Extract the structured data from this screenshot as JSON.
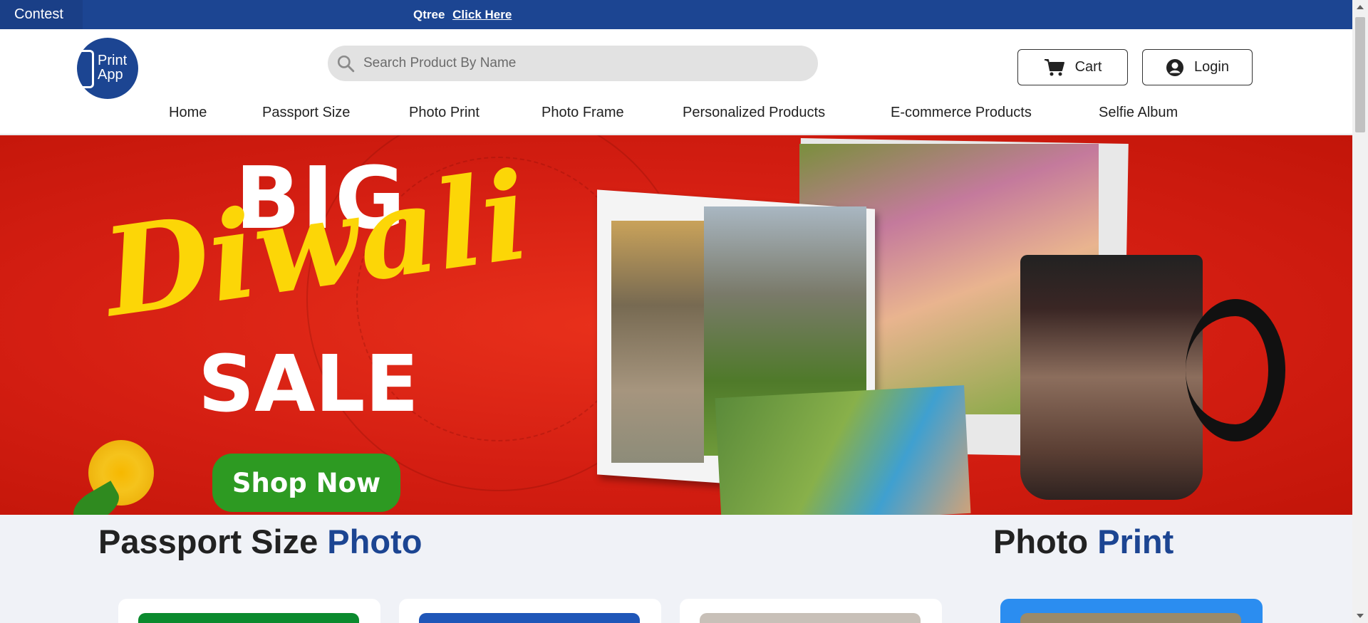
{
  "topbar": {
    "contest_label": "Contest",
    "promo_text": "Qtree",
    "promo_link": "Click Here",
    "color": "#1c4592"
  },
  "header": {
    "logo_text": "Print App",
    "search": {
      "placeholder": "Search Product By Name",
      "value": ""
    },
    "cart_label": "Cart",
    "login_label": "Login",
    "icons": {
      "search": "search-icon",
      "cart": "cart-icon",
      "login": "user-circle-icon"
    }
  },
  "nav": {
    "items": [
      {
        "label": "Home"
      },
      {
        "label": "Passport Size"
      },
      {
        "label": "Photo Print"
      },
      {
        "label": "Photo Frame"
      },
      {
        "label": "Personalized Products"
      },
      {
        "label": "E-commerce Products"
      },
      {
        "label": "Selfie Album"
      }
    ]
  },
  "banner": {
    "line1": "BIG",
    "line2": "Diwali",
    "line3": "SALE",
    "cta": "Shop Now",
    "colors": {
      "background": "#d41e12",
      "accent": "#fcd607",
      "cta": "#2d9a22"
    }
  },
  "sections": {
    "passport": {
      "title": "Passport Size",
      "accent": "Photo"
    },
    "print": {
      "title": "Photo",
      "accent": "Print"
    }
  },
  "cards": {
    "colors": [
      "#0b8a2e",
      "#1f56b8",
      "#c8c0b8",
      "#9a8a6a"
    ]
  }
}
